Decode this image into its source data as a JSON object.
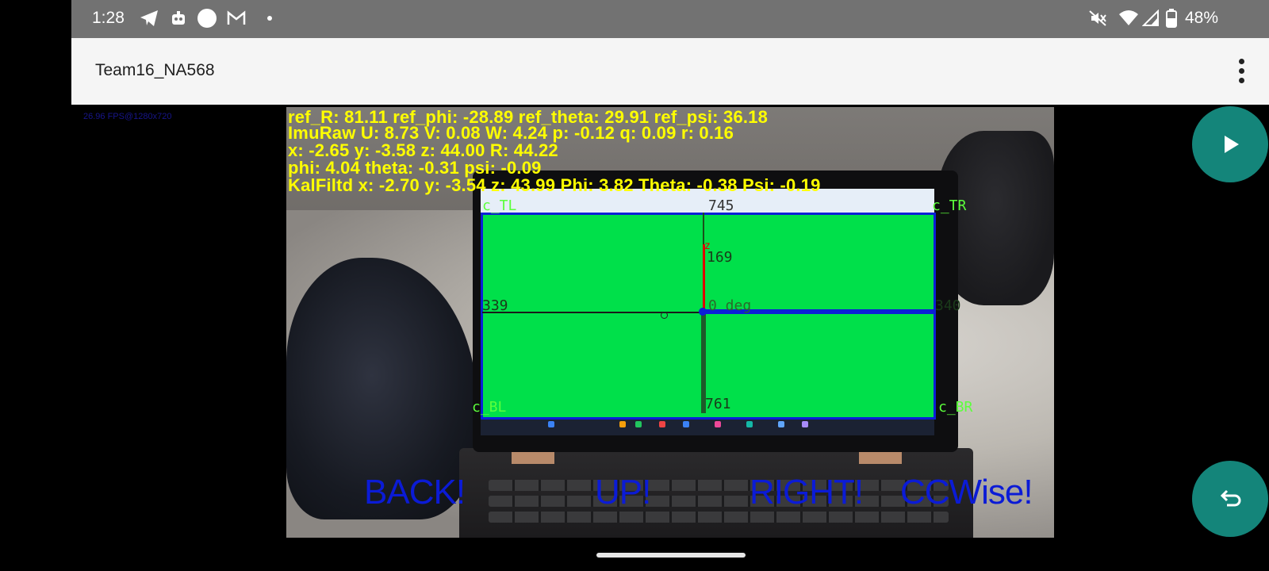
{
  "status_bar": {
    "time": "1:28",
    "battery": "48%",
    "left_icons": [
      "telegram-icon",
      "android-robot-icon",
      "circle-icon",
      "gmail-icon",
      "dot-icon"
    ],
    "right_icons": [
      "mute-icon",
      "wifi-icon",
      "signal-icon",
      "battery-icon"
    ]
  },
  "app_bar": {
    "title": "Team16_NA568"
  },
  "fps_text": "26.96 FPS@1280x720",
  "hud": {
    "line1": "ref_R: 81.11 ref_phi: -28.89 ref_theta: 29.91 ref_psi: 36.18",
    "line2": "ImuRaw U: 8.73 V: 0.08 W: 4.24 p: -0.12  q: 0.09  r: 0.16",
    "line3": "x: -2.65 y: -3.58 z: 44.00 R: 44.22",
    "line4": "phi: 4.04 theta: -0.31 psi: -0.09",
    "line5": "KalFiltd x: -2.70 y: -3.54 z: 43.99 Phi: 3.82 Theta: -0.38 Psi: -0.19"
  },
  "overlay": {
    "c_tl": "c_TL",
    "c_tr": "c_TR",
    "c_bl": "c_BL",
    "c_br": "c_BR",
    "top_value": "745",
    "bottom_value": "761",
    "left_value": "339",
    "right_value": "340",
    "z_label": "z",
    "z_value": "169",
    "angle": "0 deg"
  },
  "commands": {
    "back": "BACK!",
    "up": "UP!",
    "right": "RIGHT!",
    "rotate": "CCWise!"
  },
  "colors": {
    "hud_yellow": "#ffff00",
    "command_blue": "#0b1bd6",
    "target_green": "#00e04a",
    "fab_teal": "#14857a"
  }
}
